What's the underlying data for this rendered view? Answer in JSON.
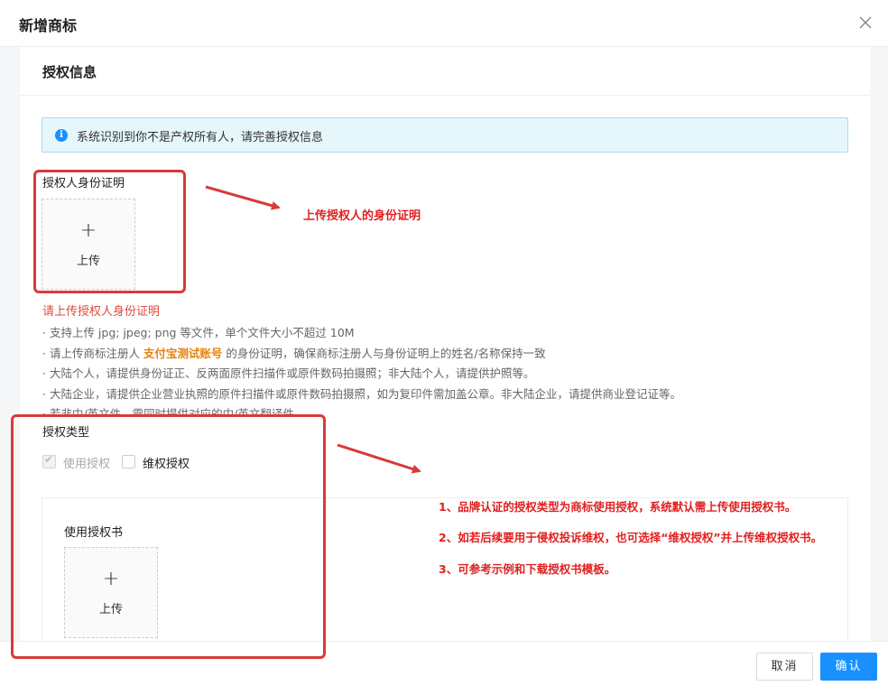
{
  "modal": {
    "title": "新增商标",
    "close_icon": "close-icon",
    "section_title": "授权信息"
  },
  "alert": {
    "icon": "info-icon",
    "text": "系统识别到你不是产权所有人，请完善授权信息",
    "color": "#1890ff"
  },
  "identity": {
    "label": "授权人身份证明",
    "upload_plus": "+",
    "upload_label": "上传",
    "error": "请上传授权人身份证明"
  },
  "tips": {
    "t1": "· 支持上传 jpg; jpeg; png 等文件，单个文件大小不超过 10M",
    "t2_pre": "· 请上传商标注册人 ",
    "t2_highlight": "支付宝测试账号",
    "t2_post": " 的身份证明，确保商标注册人与身份证明上的姓名/名称保持一致",
    "t3": "· 大陆个人，请提供身份证正、反两面原件扫描件或原件数码拍摄照；非大陆个人，请提供护照等。",
    "t4": "· 大陆企业，请提供企业营业执照的原件扫描件或原件数码拍摄照，如为复印件需加盖公章。非大陆企业，请提供商业登记证等。",
    "t5": "· 若非中/英文件，需同时提供对应的中/英文翻译件"
  },
  "auth_type": {
    "label": "授权类型",
    "option_use": "使用授权",
    "option_use_checked": true,
    "option_use_disabled": true,
    "option_protect": "维权授权",
    "option_protect_checked": false
  },
  "use_letter": {
    "label": "使用授权书",
    "upload_plus": "+",
    "upload_label": "上传"
  },
  "footer": {
    "cancel_label": "取消",
    "confirm_label": "确认",
    "confirm_color": "#1890ff"
  },
  "annotations": {
    "note_identity": "上传授权人的身份证明",
    "note_1": "1、品牌认证的授权类型为商标使用授权，系统默认需上传使用授权书。",
    "note_2": "2、如若后续要用于侵权投诉维权，也可选择“维权授权”并上传维权授权书。",
    "note_3": "3、可参考示例和下载授权书模板。",
    "color": "#d93a3a"
  }
}
